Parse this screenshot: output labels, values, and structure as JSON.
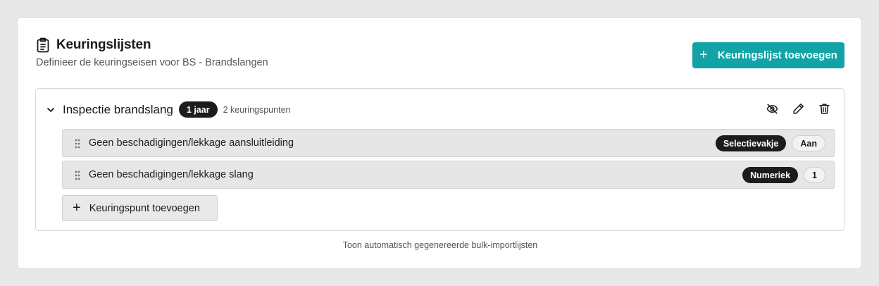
{
  "card": {
    "title": "Keuringslijsten",
    "subtitle": "Definieer de keuringseisen voor BS - Brandslangen",
    "add_button": {
      "icon": "plus-icon",
      "label": "Keuringslijst toevoegen"
    }
  },
  "checklist": {
    "title": "Inspectie brandslang",
    "interval_badge": "1 jaar",
    "count_text": "2 keuringspunten",
    "actions": [
      "hide-icon",
      "edit-icon",
      "trash-icon"
    ],
    "items": [
      {
        "label": "Geen beschadigingen/lekkage aansluitleiding",
        "type": "Selectievakje",
        "value": "Aan"
      },
      {
        "label": "Geen beschadigingen/lekkage slang",
        "type": "Numeriek",
        "value": "1"
      }
    ],
    "add_item_button": {
      "icon": "plus-icon",
      "label": "Keuringspunt toevoegen"
    }
  },
  "footer_link": "Toon automatisch gegenereerde bulk-importlijsten",
  "colors": {
    "accent": "#12a3a6",
    "badge_dark": "#1c1c1c",
    "background": "#e8e8e8"
  }
}
